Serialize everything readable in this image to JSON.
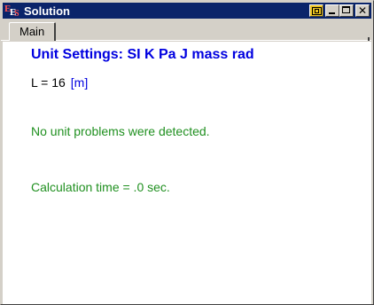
{
  "window": {
    "title": "Solution",
    "app_icon": "ees-app-icon",
    "buttons": [
      "pin-icon",
      "minimize-icon",
      "maximize-icon",
      "close-icon"
    ],
    "close_glyph": "✕"
  },
  "tabs": [
    {
      "label": "Main",
      "active": true
    }
  ],
  "solution": {
    "unit_settings": "Unit Settings: SI K Pa J mass rad",
    "variable": {
      "text": "L = 16",
      "unit": "[m]"
    },
    "unit_check": "No unit problems were detected.",
    "calc_time": "Calculation time = .0 sec."
  },
  "colors": {
    "titlebar": "#0a246a",
    "heading": "#0000e0",
    "unit": "#0000e0",
    "message": "#209020",
    "chrome": "#d4d0c8"
  }
}
